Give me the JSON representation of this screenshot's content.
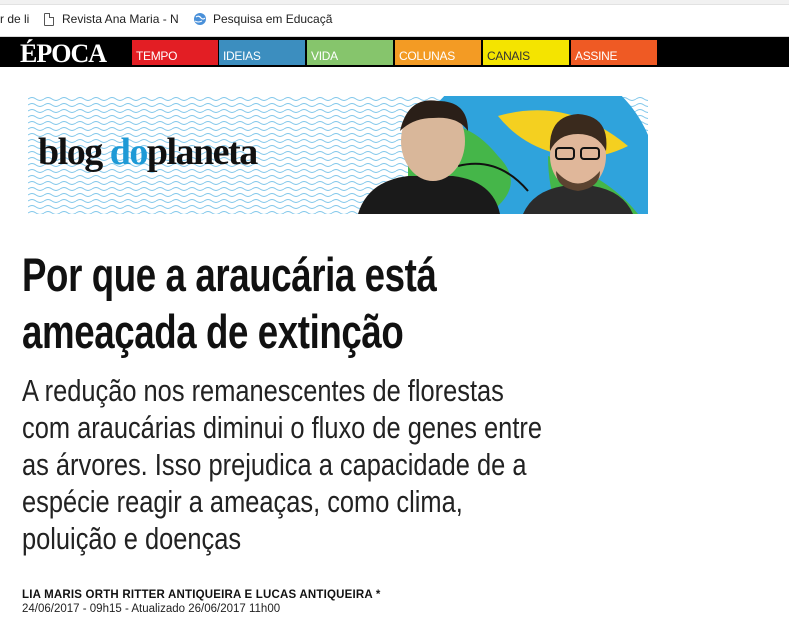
{
  "bookmarks": [
    {
      "label": "r de li"
    },
    {
      "label": "Revista Ana Maria - N"
    },
    {
      "label": "Pesquisa em Educaçã"
    }
  ],
  "nav": {
    "logo": "ÉPOCA",
    "items": [
      {
        "label": "TEMPO",
        "color": "#e31e24"
      },
      {
        "label": "IDEIAS",
        "color": "#3c8ebf"
      },
      {
        "label": "VIDA",
        "color": "#86c56c"
      },
      {
        "label": "COLUNAS",
        "color": "#f39b24"
      },
      {
        "label": "CANAIS",
        "color": "#f4e400"
      },
      {
        "label": "ASSINE",
        "color": "#ef5a24"
      }
    ]
  },
  "banner": {
    "blog_word1": "blog",
    "blog_word2": "do",
    "blog_word3": "planeta",
    "accent": "#1e9ad6"
  },
  "article": {
    "headline": "Por que a araucária está ameaçada de extinção",
    "subtitle": "A redução nos remanescentes de florestas com araucárias diminui o fluxo de genes entre as árvores. Isso prejudica a capacidade de a espécie reagir a ameaças, como clima, poluição e doenças",
    "authors": "LIA MARIS ORTH RITTER ANTIQUEIRA E LUCAS ANTIQUEIRA *",
    "dates": "24/06/2017 - 09h15 - Atualizado 26/06/2017 11h00"
  }
}
